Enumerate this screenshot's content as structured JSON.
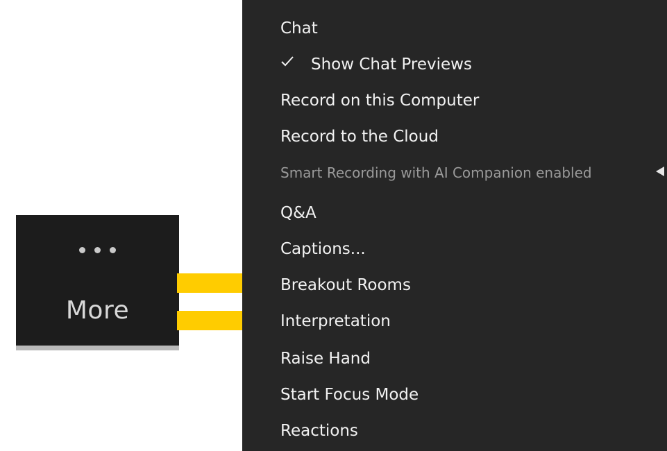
{
  "more_button": {
    "label": "More",
    "icon": "ellipsis-icon"
  },
  "menu": {
    "items": [
      {
        "label": "Chat"
      },
      {
        "label": "Show Chat Previews",
        "checked": true
      },
      {
        "label": "Record on this Computer"
      },
      {
        "label": "Record to the Cloud"
      },
      {
        "label": "Smart Recording with AI Companion enabled",
        "disabled": true,
        "has_submenu": true
      },
      {
        "label": "Q&A"
      },
      {
        "label": "Captions..."
      },
      {
        "label": "Breakout Rooms",
        "highlighted_by_arrow": true
      },
      {
        "label": "Interpretation",
        "highlighted_by_arrow": true
      },
      {
        "label": "Raise Hand"
      },
      {
        "label": "Start Focus Mode"
      },
      {
        "label": "Reactions"
      }
    ]
  },
  "colors": {
    "menu_bg": "#262626",
    "button_bg": "#1c1c1c",
    "arrow": "#ffcc00",
    "menu_text": "#f2f2f2",
    "disabled_text": "#9a9a9a"
  }
}
